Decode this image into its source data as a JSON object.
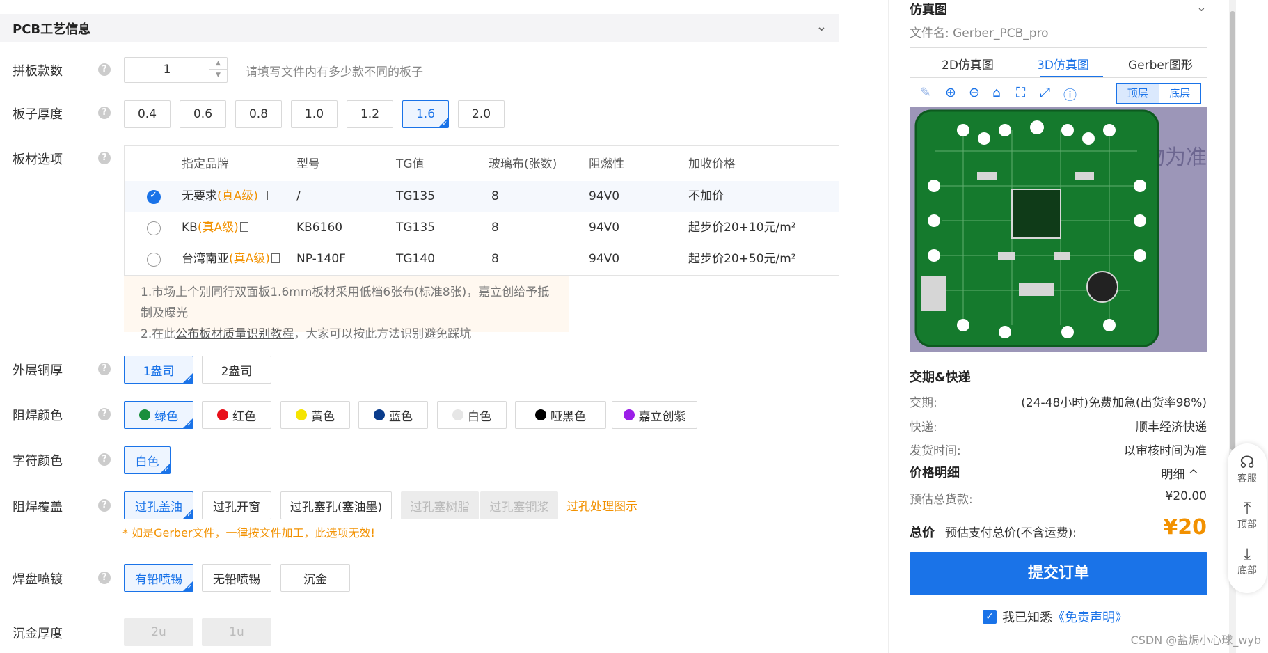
{
  "section": {
    "title": "PCB工艺信息"
  },
  "rows": {
    "panel_count": {
      "label": "拼板款数",
      "value": "1",
      "hint": "请填写文件内有多少款不同的板子"
    },
    "thickness": {
      "label": "板子厚度",
      "options": [
        "0.4",
        "0.6",
        "0.8",
        "1.0",
        "1.2",
        "1.6",
        "2.0"
      ],
      "selected": "1.6"
    },
    "material": {
      "label": "板材选项",
      "headers": [
        "指定品牌",
        "型号",
        "TG值",
        "玻璃布(张数)",
        "阻燃性",
        "加收价格"
      ],
      "rows": [
        {
          "brand": "无要求",
          "grade": "(真A级)",
          "model": "/",
          "tg": "TG135",
          "glass": "8",
          "flame": "94V0",
          "price": "不加价",
          "selected": true
        },
        {
          "brand": "KB",
          "grade": "(真A级)",
          "model": "KB6160",
          "tg": "TG135",
          "glass": "8",
          "flame": "94V0",
          "price": "起步价20+10元/m²",
          "selected": false
        },
        {
          "brand": "台湾南亚",
          "grade": "(真A级)",
          "model": "NP-140F",
          "tg": "TG140",
          "glass": "8",
          "flame": "94V0",
          "price": "起步价20+50元/m²",
          "selected": false
        }
      ],
      "note_line1": "1.市场上个别同行双面板1.6mm板材采用低档6张布(标准8张)，嘉立创给予抵制及曝光",
      "note_line2_prefix": "2.在此",
      "note_line2_link": "公布板材质量识别教程",
      "note_line2_suffix": "，大家可以按此方法识别避免踩坑"
    },
    "copper": {
      "label": "外层铜厚",
      "options": [
        "1盎司",
        "2盎司"
      ],
      "selected": "1盎司"
    },
    "mask_color": {
      "label": "阻焊颜色",
      "options": [
        {
          "name": "绿色",
          "color": "#1a8f3c"
        },
        {
          "name": "红色",
          "color": "#e8101a"
        },
        {
          "name": "黄色",
          "color": "#f5e400"
        },
        {
          "name": "蓝色",
          "color": "#0a3c8c"
        },
        {
          "name": "白色",
          "color": "#e6e6e6"
        },
        {
          "name": "哑黑色",
          "color": "#000000"
        },
        {
          "name": "嘉立创紫",
          "color": "#9b1fe8"
        }
      ],
      "selected": "绿色"
    },
    "silk_color": {
      "label": "字符颜色",
      "options": [
        "白色"
      ],
      "selected": "白色"
    },
    "mask_cover": {
      "label": "阻焊覆盖",
      "options": [
        "过孔盖油",
        "过孔开窗",
        "过孔塞孔(塞油墨)",
        "过孔塞树脂",
        "过孔塞铜浆"
      ],
      "selected": "过孔盖油",
      "disabled": [
        "过孔塞树脂",
        "过孔塞铜浆"
      ],
      "link": "过孔处理图示",
      "warning": "* 如是Gerber文件，一律按文件加工，此选项无效!"
    },
    "surface": {
      "label": "焊盘喷镀",
      "options": [
        "有铅喷锡",
        "无铅喷锡",
        "沉金"
      ],
      "selected": "有铅喷锡"
    },
    "gold_thickness": {
      "label": "沉金厚度",
      "options": [
        "2u",
        "1u"
      ]
    }
  },
  "right": {
    "sim_title": "仿真图",
    "filename": "文件名: Gerber_PCB_pro",
    "tabs": [
      "2D仿真图",
      "3D仿真图",
      "Gerber图形"
    ],
    "active_tab": "3D仿真图",
    "layer_top": "顶层",
    "layer_bottom": "底层",
    "watermark_text": "物为准",
    "delivery_title": "交期&快递",
    "delivery": [
      {
        "k": "交期:",
        "v": "(24-48小时)免费加急(出货率98%)"
      },
      {
        "k": "快递:",
        "v": "顺丰经济快递"
      },
      {
        "k": "发货时间:",
        "v": "以审核时间为准"
      }
    ],
    "price_title": "价格明细",
    "price_detail_toggle": "明细 ^",
    "est_label": "预估总货款:",
    "est_value": "¥20.00",
    "total_label": "总价",
    "total_sub": "预估支付总价(不含运费):",
    "total_value": "¥20",
    "submit": "提交订单",
    "agree_text": "我已知悉",
    "agree_link": "《免责声明》"
  },
  "float": [
    {
      "icon": "headset-icon",
      "label": "客服"
    },
    {
      "icon": "to-top-icon",
      "label": "顶部"
    },
    {
      "icon": "to-bottom-icon",
      "label": "底部"
    }
  ],
  "watermark": "CSDN @盐焗小心球_wyb",
  "colors": {
    "accent": "#1a73e8",
    "orange": "#f29100",
    "pcb_green": "#157a2d"
  }
}
